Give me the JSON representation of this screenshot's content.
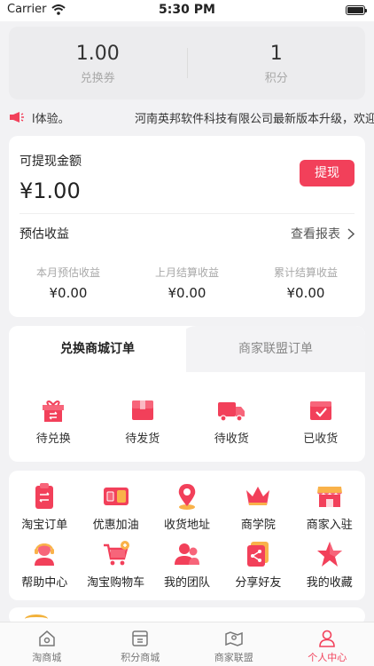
{
  "status_bar": {
    "carrier": "Carrier",
    "time": "5:30 PM"
  },
  "summary": {
    "voucher_value": "1.00",
    "voucher_label": "兑换券",
    "points_value": "1",
    "points_label": "积分"
  },
  "notice": {
    "text_left": "l体验。",
    "text_right": "河南英邦软件科技有限公司最新版本升级，欢迎"
  },
  "earnings": {
    "withdrawable_label": "可提现金额",
    "withdrawable_amount": "¥1.00",
    "withdraw_button": "提现",
    "estimated_label": "预估收益",
    "report_link": "查看报表",
    "stats": [
      {
        "label": "本月预估收益",
        "value": "¥0.00"
      },
      {
        "label": "上月结算收益",
        "value": "¥0.00"
      },
      {
        "label": "累计结算收益",
        "value": "¥0.00"
      }
    ]
  },
  "orders": {
    "tab_active": "兑换商城订单",
    "tab_other": "商家联盟订单",
    "items": [
      {
        "label": "待兑换",
        "icon": "gift-box-icon"
      },
      {
        "label": "待发货",
        "icon": "package-icon"
      },
      {
        "label": "待收货",
        "icon": "truck-icon"
      },
      {
        "label": "已收货",
        "icon": "received-box-icon"
      }
    ]
  },
  "tools": [
    {
      "label": "淘宝订单",
      "icon": "clipboard-icon"
    },
    {
      "label": "优惠加油",
      "icon": "fuel-coupon-icon"
    },
    {
      "label": "收货地址",
      "icon": "location-pin-icon"
    },
    {
      "label": "商学院",
      "icon": "crown-icon"
    },
    {
      "label": "商家入驻",
      "icon": "storefront-icon"
    },
    {
      "label": "帮助中心",
      "icon": "headset-icon"
    },
    {
      "label": "淘宝购物车",
      "icon": "shopping-cart-icon"
    },
    {
      "label": "我的团队",
      "icon": "team-icon"
    },
    {
      "label": "分享好友",
      "icon": "share-icon"
    },
    {
      "label": "我的收藏",
      "icon": "star-icon"
    }
  ],
  "tabbar": [
    {
      "label": "淘商城",
      "icon": "home-icon"
    },
    {
      "label": "积分商城",
      "icon": "points-shop-icon"
    },
    {
      "label": "商家联盟",
      "icon": "map-icon"
    },
    {
      "label": "个人中心",
      "icon": "person-icon",
      "active": true
    }
  ],
  "colors": {
    "accent": "#f2405a",
    "secondary_text": "#a8a8a8",
    "background": "#f2f2f4"
  }
}
